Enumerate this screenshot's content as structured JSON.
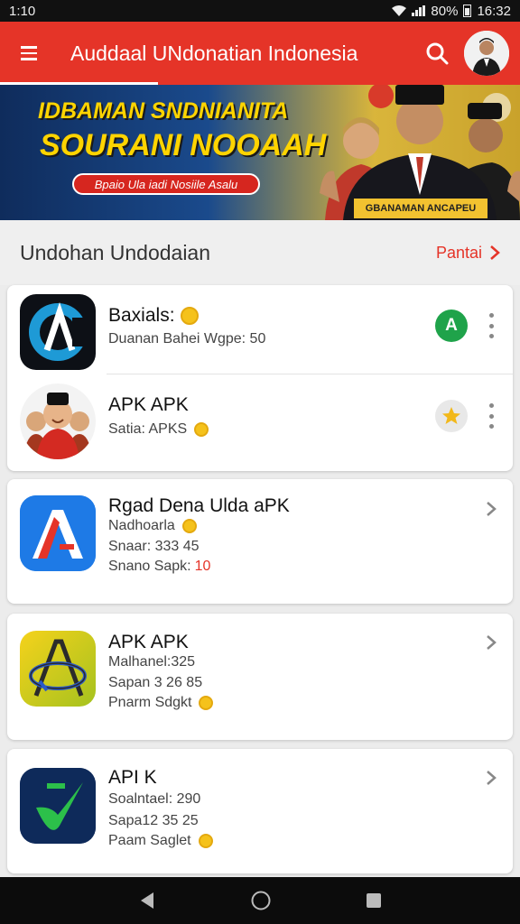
{
  "status_bar": {
    "time": "1:10",
    "battery": "80%",
    "clock": "16:32"
  },
  "app_bar": {
    "title": "Auddaal UNdonatian Indonesia"
  },
  "banner": {
    "headline_1": "IDBAMAN SNDNIANITA",
    "headline_2": "SOURANI NOOAAH",
    "pill_text": "Bpaio Ula iadi Nosiile Asalu",
    "tag_text": "GBANAMAN ANCAPEU"
  },
  "section": {
    "title": "Undohan Undodaian",
    "see_all": "Pantai"
  },
  "card1": {
    "items": [
      {
        "title": "Baxials:",
        "subtitle": "Duanan Bahei Wgpe: 50",
        "icon": "stylized-a-icon",
        "badge": "A"
      },
      {
        "title": "APK APK",
        "subtitle": "Satia: APKS",
        "icon": "cartoon-people-icon",
        "badge": "star"
      }
    ]
  },
  "cards": [
    {
      "title": "Rgad Dena Ulda aPK",
      "line1": "Nadhoarla",
      "line2": "Snaar: 333 45",
      "line3": "Snano Sapk:",
      "line3_value": "10",
      "icon": "red-a-logo-icon"
    },
    {
      "title": "APK APK",
      "line1": "Malhanel:325",
      "line2": "Sapan 3 26 85",
      "line3": "Pnarm Sdgkt",
      "icon": "yellow-a-logo-icon"
    },
    {
      "title": "API K",
      "line1": "Soalntael: 290",
      "line2": "Sapa12 35 25",
      "line3": "Paam Saglet",
      "icon": "green-check-logo-icon"
    }
  ],
  "colors": {
    "accent": "#e53428",
    "coin": "#f5c21b",
    "badge_green": "#1fa34a"
  }
}
